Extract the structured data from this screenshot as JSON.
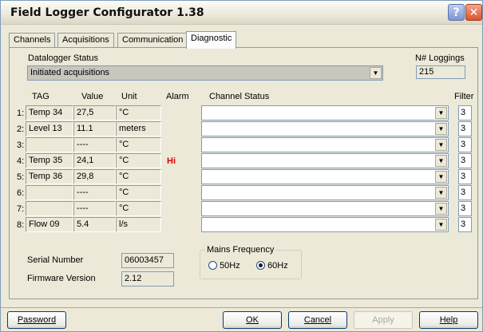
{
  "window": {
    "title": "Field Logger Configurator 1.38",
    "help_icon": "question-mark",
    "close_icon": "x"
  },
  "tabs": [
    {
      "label": "Channels",
      "active": false
    },
    {
      "label": "Acquisitions",
      "active": false
    },
    {
      "label": "Communication",
      "active": false
    },
    {
      "label": "Diagnostic",
      "active": true
    }
  ],
  "diagnostic": {
    "status_label": "Datalogger Status",
    "status_value": "Initiated acquisitions",
    "loggings_label": "N# Loggings",
    "loggings_value": "215",
    "headers": {
      "tag": "TAG",
      "value": "Value",
      "unit": "Unit",
      "alarm": "Alarm",
      "channel_status": "Channel Status",
      "filter": "Filter"
    },
    "rows": [
      {
        "num": "1:",
        "tag": "Temp 34",
        "value": "27,5",
        "unit": "°C",
        "alarm": "",
        "status": "",
        "filter": "3"
      },
      {
        "num": "2:",
        "tag": "Level 13",
        "value": "11.1",
        "unit": "meters",
        "alarm": "",
        "status": "",
        "filter": "3"
      },
      {
        "num": "3:",
        "tag": "",
        "value": "----",
        "unit": "°C",
        "alarm": "",
        "status": "",
        "filter": "3"
      },
      {
        "num": "4:",
        "tag": "Temp 35",
        "value": "24,1",
        "unit": "°C",
        "alarm": "Hi",
        "status": "",
        "filter": "3"
      },
      {
        "num": "5:",
        "tag": "Temp 36",
        "value": "29,8",
        "unit": "°C",
        "alarm": "",
        "status": "",
        "filter": "3"
      },
      {
        "num": "6:",
        "tag": "",
        "value": "----",
        "unit": "°C",
        "alarm": "",
        "status": "",
        "filter": "3"
      },
      {
        "num": "7:",
        "tag": "",
        "value": "----",
        "unit": "°C",
        "alarm": "",
        "status": "",
        "filter": "3"
      },
      {
        "num": "8:",
        "tag": "Flow 09",
        "value": "5.4",
        "unit": "l/s",
        "alarm": "",
        "status": "",
        "filter": "3"
      }
    ],
    "serial_label": "Serial Number",
    "serial_value": "06003457",
    "firmware_label": "Firmware Version",
    "firmware_value": "2.12",
    "mains": {
      "title": "Mains Frequency",
      "options": [
        {
          "label": "50Hz",
          "selected": false
        },
        {
          "label": "60Hz",
          "selected": true
        }
      ]
    }
  },
  "buttons": {
    "password": "Password",
    "ok": "OK",
    "cancel": "Cancel",
    "apply": "Apply",
    "help": "Help"
  },
  "colors": {
    "alarm": "#e00000",
    "window_bg": "#ece9d8"
  }
}
